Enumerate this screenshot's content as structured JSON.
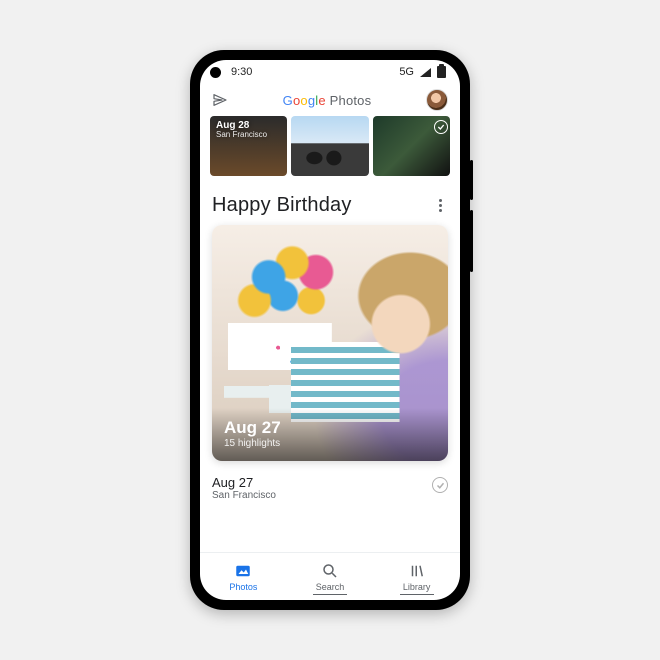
{
  "status": {
    "time": "9:30",
    "network": "5G"
  },
  "app": {
    "brand": "Google",
    "product": "Photos"
  },
  "strip": {
    "date": "Aug 28",
    "location": "San Francisco"
  },
  "highlight": {
    "title": "Happy Birthday",
    "date": "Aug 27",
    "subtitle": "15 highlights"
  },
  "section": {
    "date": "Aug 27",
    "location": "San Francisco"
  },
  "nav": {
    "photos": "Photos",
    "search": "Search",
    "library": "Library"
  }
}
